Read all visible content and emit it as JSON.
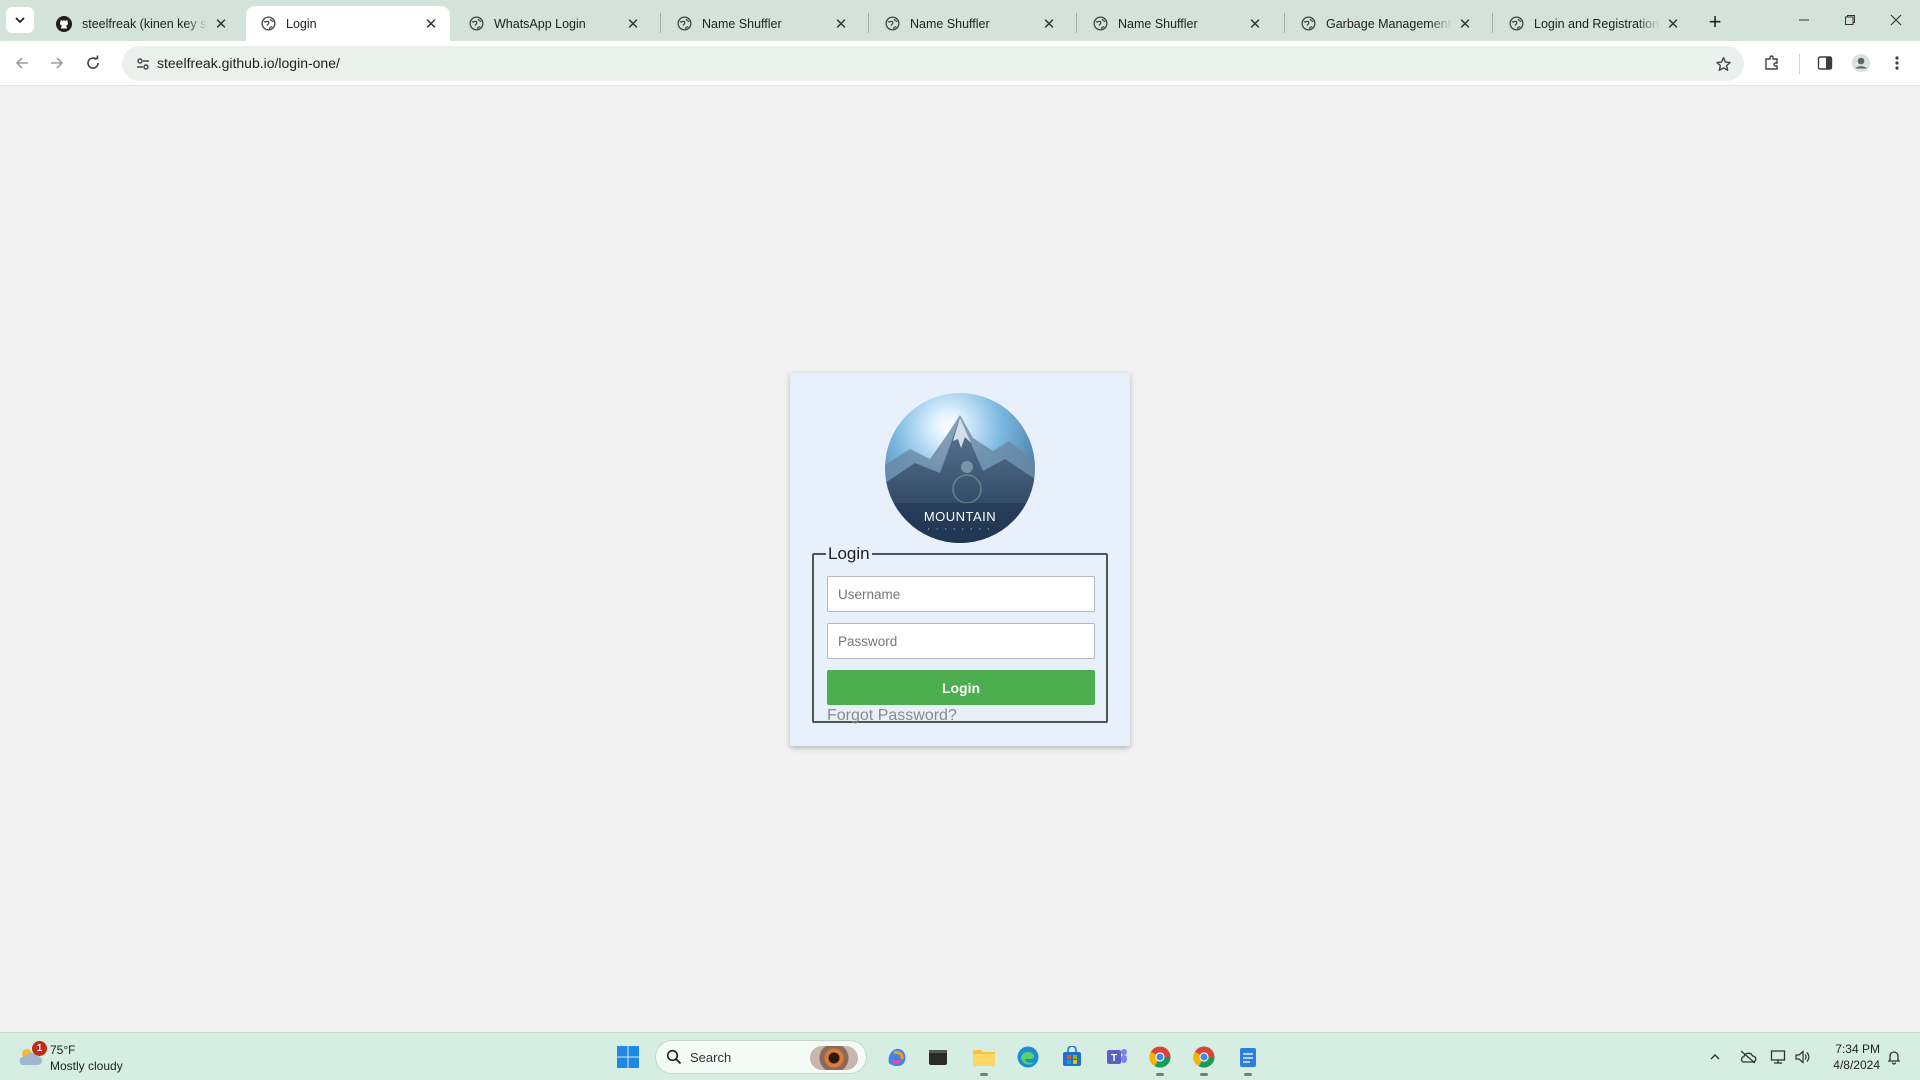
{
  "browser": {
    "tabs": [
      {
        "title": "steelfreak (kinen key sam",
        "favicon": "github-icon",
        "active": false
      },
      {
        "title": "Login",
        "favicon": "globe-icon",
        "active": true
      },
      {
        "title": "WhatsApp Login",
        "favicon": "globe-icon",
        "active": false
      },
      {
        "title": "Name Shuffler",
        "favicon": "globe-icon",
        "active": false
      },
      {
        "title": "Name Shuffler",
        "favicon": "globe-icon",
        "active": false
      },
      {
        "title": "Name Shuffler",
        "favicon": "globe-icon",
        "active": false
      },
      {
        "title": "Garbage Management Sy",
        "favicon": "globe-icon",
        "active": false
      },
      {
        "title": "Login and Registration Sy",
        "favicon": "globe-icon",
        "active": false
      }
    ],
    "url": "steelfreak.github.io/login-one/"
  },
  "page": {
    "logo_text": "MOUNTAIN",
    "form": {
      "legend": "Login",
      "username_placeholder": "Username",
      "password_placeholder": "Password",
      "submit_label": "Login",
      "forgot_link": "Forgot Password?"
    },
    "colors": {
      "button": "#4cae4f",
      "card_bg": "#e8f1fb"
    }
  },
  "taskbar": {
    "weather": {
      "temp": "75°F",
      "desc": "Mostly cloudy",
      "badge": "1"
    },
    "search_placeholder": "Search",
    "time": "7:34 PM",
    "date": "4/8/2024"
  }
}
